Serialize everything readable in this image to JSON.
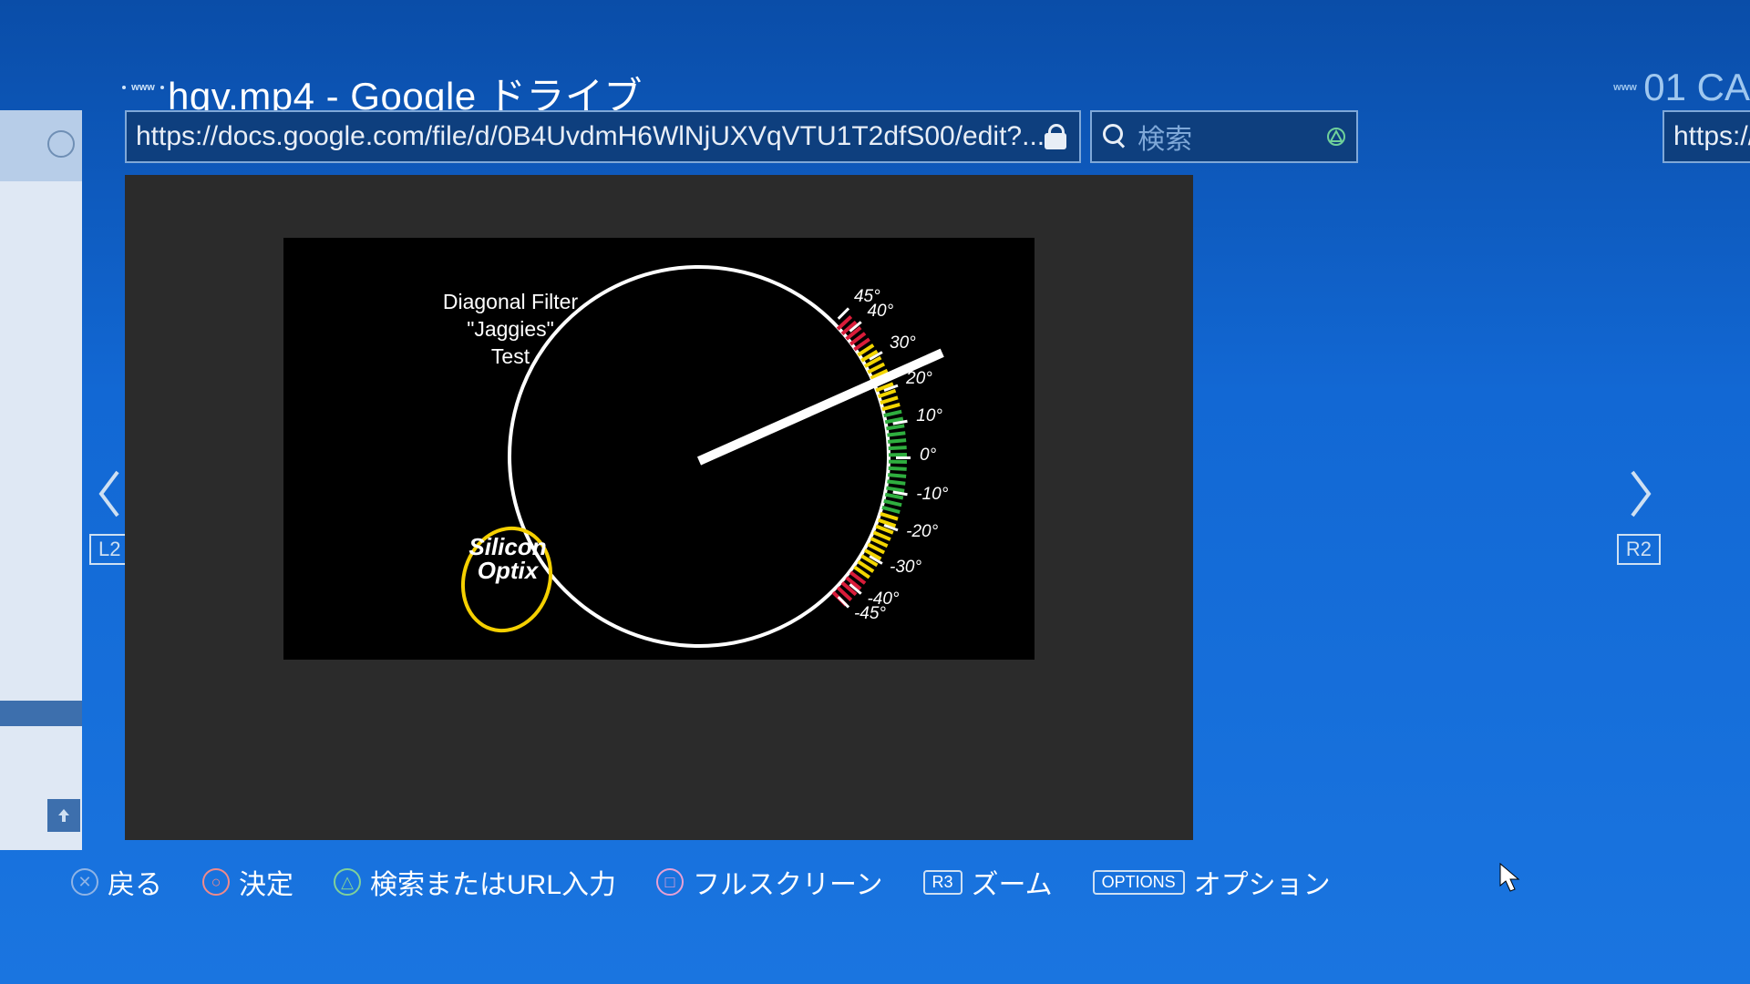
{
  "tab": {
    "title": "hqv.mp4 - Google ドライブ",
    "right_peek_title": "01 CA"
  },
  "nav": {
    "url": "https://docs.google.com/file/d/0B4UvdmH6WlNjUXVqVTU1T2dfS00/edit?...",
    "search_placeholder": "検索",
    "right_peek_url": "https://c"
  },
  "shoulders": {
    "left": "L2",
    "right": "R2"
  },
  "gauge": {
    "title_line1": "Diagonal Filter",
    "title_line2": "\"Jaggies\"",
    "title_line3": "Test",
    "logo_line1": "Silicon",
    "logo_line2": "Optix",
    "labels": [
      "45°",
      "40°",
      "30°",
      "20°",
      "10°",
      "0°",
      "-10°",
      "-20°",
      "-30°",
      "-40°",
      "-45°"
    ]
  },
  "legend": {
    "back": "戻る",
    "confirm": "決定",
    "search_url": "検索またはURL入力",
    "fullscreen": "フルスクリーン",
    "zoom_btn": "R3",
    "zoom": "ズーム",
    "options_btn": "OPTIONS",
    "options": "オプション"
  }
}
